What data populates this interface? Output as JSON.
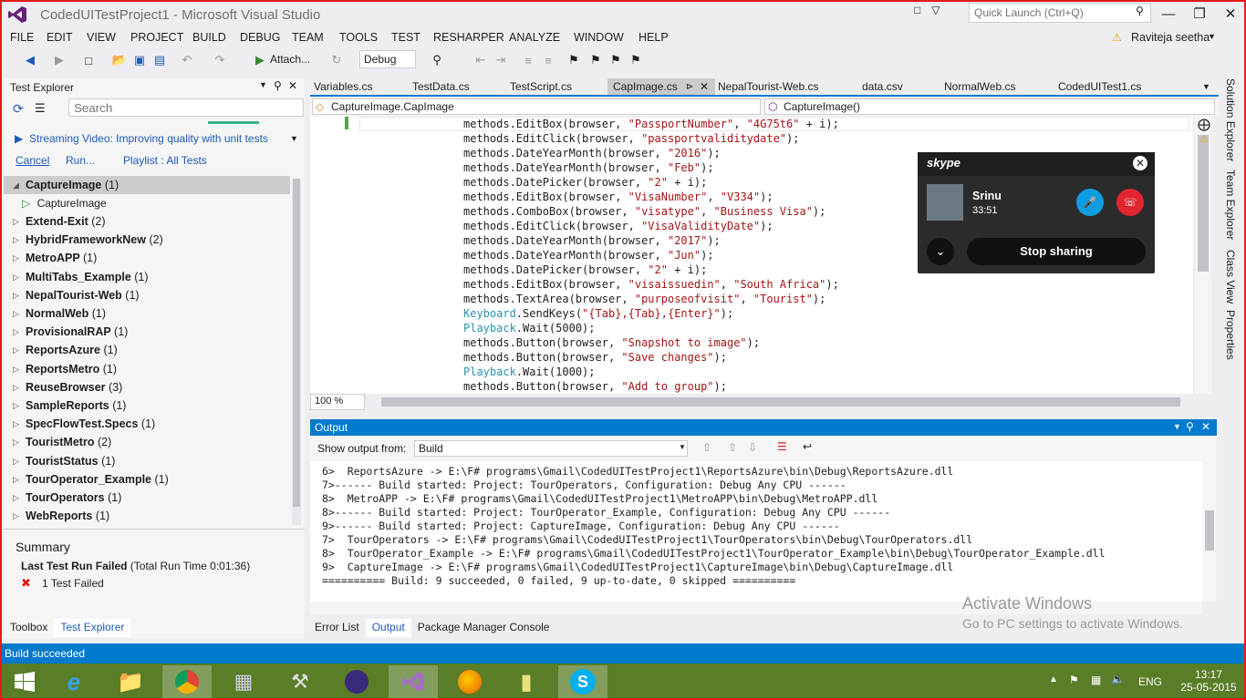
{
  "window": {
    "title": "CodedUITestProject1 - Microsoft Visual Studio",
    "quick_launch_placeholder": "Quick Launch (Ctrl+Q)",
    "user": "Raviteja seetha"
  },
  "menu": [
    "FILE",
    "EDIT",
    "VIEW",
    "PROJECT",
    "BUILD",
    "DEBUG",
    "TEAM",
    "TOOLS",
    "TEST",
    "RESHARPER",
    "ANALYZE",
    "WINDOW",
    "HELP"
  ],
  "toolbar": {
    "attach_label": "Attach...",
    "config": "Debug"
  },
  "test_explorer": {
    "title": "Test Explorer",
    "search_placeholder": "Search",
    "streaming_link": "Streaming Video: Improving quality with unit tests",
    "cancel": "Cancel",
    "run": "Run...",
    "playlist": "Playlist : All Tests",
    "groups": [
      {
        "name": "CaptureImage",
        "count": "(1)",
        "expanded": true
      },
      {
        "name": "Extend-Exit",
        "count": "(2)"
      },
      {
        "name": "HybridFrameworkNew",
        "count": "(2)"
      },
      {
        "name": "MetroAPP",
        "count": "(1)"
      },
      {
        "name": "MultiTabs_Example",
        "count": "(1)"
      },
      {
        "name": "NepalTourist-Web",
        "count": "(1)"
      },
      {
        "name": "NormalWeb",
        "count": "(1)"
      },
      {
        "name": "ProvisionalRAP",
        "count": "(1)"
      },
      {
        "name": "ReportsAzure",
        "count": "(1)"
      },
      {
        "name": "ReportsMetro",
        "count": "(1)"
      },
      {
        "name": "ReuseBrowser",
        "count": "(3)"
      },
      {
        "name": "SampleReports",
        "count": "(1)"
      },
      {
        "name": "SpecFlowTest.Specs",
        "count": "(1)"
      },
      {
        "name": "TouristMetro",
        "count": "(2)"
      },
      {
        "name": "TouristStatus",
        "count": "(1)"
      },
      {
        "name": "TourOperator_Example",
        "count": "(1)"
      },
      {
        "name": "TourOperators",
        "count": "(1)"
      },
      {
        "name": "WebReports",
        "count": "(1)"
      }
    ],
    "child_test": "CaptureImage",
    "summary_title": "Summary",
    "last_run_bold": "Last Test Run Failed",
    "last_run_rest": " (Total Run Time 0:01:36)",
    "failed_text": "1 Test Failed"
  },
  "left_tabs": [
    "Toolbox",
    "Test Explorer"
  ],
  "doc_tabs": [
    "Variables.cs",
    "TestData.cs",
    "TestScript.cs",
    "CapImage.cs",
    "NepalTourist-Web.cs",
    "data.csv",
    "NormalWeb.cs",
    "CodedUITest1.cs"
  ],
  "nav": {
    "left": "CaptureImage.CapImage",
    "right": "CaptureImage()"
  },
  "zoom": "100 %",
  "right_tabs": [
    "Solution Explorer",
    "Team Explorer",
    "Class View",
    "Properties"
  ],
  "output": {
    "title": "Output",
    "show_from_label": "Show output from:",
    "source": "Build",
    "lines": [
      "6>  ReportsAzure -> E:\\F# programs\\Gmail\\CodedUITestProject1\\ReportsAzure\\bin\\Debug\\ReportsAzure.dll",
      "7>------ Build started: Project: TourOperators, Configuration: Debug Any CPU ------",
      "8>  MetroAPP -> E:\\F# programs\\Gmail\\CodedUITestProject1\\MetroAPP\\bin\\Debug\\MetroAPP.dll",
      "8>------ Build started: Project: TourOperator_Example, Configuration: Debug Any CPU ------",
      "9>------ Build started: Project: CaptureImage, Configuration: Debug Any CPU ------",
      "7>  TourOperators -> E:\\F# programs\\Gmail\\CodedUITestProject1\\TourOperators\\bin\\Debug\\TourOperators.dll",
      "8>  TourOperator_Example -> E:\\F# programs\\Gmail\\CodedUITestProject1\\TourOperator_Example\\bin\\Debug\\TourOperator_Example.dll",
      "9>  CaptureImage -> E:\\F# programs\\Gmail\\CodedUITestProject1\\CaptureImage\\bin\\Debug\\CaptureImage.dll",
      "========== Build: 9 succeeded, 0 failed, 9 up-to-date, 0 skipped =========="
    ]
  },
  "bottom_tabs": [
    "Error List",
    "Output",
    "Package Manager Console"
  ],
  "watermark": {
    "line1": "Activate Windows",
    "line2": "Go to PC settings to activate Windows."
  },
  "skype": {
    "logo": "skype",
    "name": "Srinu",
    "time": "33:51",
    "stop_label": "Stop sharing"
  },
  "status": "Build succeeded",
  "tray": {
    "lang": "ENG",
    "time": "13:17",
    "date": "25-05-2015"
  },
  "accent": "#007acc"
}
